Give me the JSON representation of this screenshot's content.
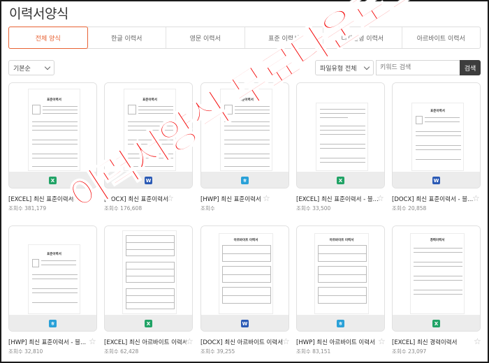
{
  "page_title": "이력서양식",
  "tabs": [
    {
      "label": "전체 양식",
      "active": true
    },
    {
      "label": "한글 이력서",
      "active": false
    },
    {
      "label": "영문 이력서",
      "active": false
    },
    {
      "label": "표준 이력서",
      "active": false
    },
    {
      "label": "디자인형 이력서",
      "active": false
    },
    {
      "label": "아르바이트 이력서",
      "active": false
    }
  ],
  "filters": {
    "sort_value": "기본순",
    "file_type_value": "파일유형 전체",
    "search_placeholder": "키워드 검색",
    "search_button": "검색"
  },
  "cards": [
    {
      "title": "[EXCEL] 최신 표준이력서",
      "views": "조회수 381,179",
      "file_type": "excel",
      "doc_title": "표준이력서"
    },
    {
      "title": "[DOCX] 최신 표준이력서",
      "views": "조회수 176,608",
      "file_type": "word",
      "doc_title": "표준이력서"
    },
    {
      "title": "[HWP] 최신 표준이력서",
      "views": "조회수 ",
      "file_type": "hwp",
      "doc_title": "표준이력서"
    },
    {
      "title": "[EXCEL] 최신 표준이력서 - 블...",
      "views": "조회수 33,500",
      "file_type": "excel",
      "doc_title": ""
    },
    {
      "title": "[DOCX] 최신 표준이력서 - 블...",
      "views": "조회수 20,858",
      "file_type": "word",
      "doc_title": "표준이력서"
    },
    {
      "title": "[HWP] 최신 표준이력서 - 블...",
      "views": "조회수 32,810",
      "file_type": "hwp",
      "doc_title": "표준이력서"
    },
    {
      "title": "[EXCEL] 최신 아르바이트 이력서",
      "views": "조회수 62,428",
      "file_type": "excel",
      "doc_title": ""
    },
    {
      "title": "[DOCX] 최신 아르바이트 이력서",
      "views": "조회수 39,255",
      "file_type": "word",
      "doc_title": "아르바이트 이력서"
    },
    {
      "title": "[HWP] 최신 아르바이트 이력서",
      "views": "조회수 83,151",
      "file_type": "hwp",
      "doc_title": "아르바이트 이력서"
    },
    {
      "title": "[EXCEL] 최신 경력이력서",
      "views": "조회수 23,097",
      "file_type": "excel",
      "doc_title": "경력이력서"
    }
  ],
  "icons": {
    "excel": "X",
    "word": "W",
    "hwp": "ㅎ",
    "star": "☆"
  },
  "colors": {
    "accent": "#e86233",
    "excel": "#21a366",
    "word": "#2b5ab5",
    "hwp": "#2aa1d8",
    "overlay": "#f40000"
  },
  "overlay_text": "이력서양식 무료다운로드"
}
